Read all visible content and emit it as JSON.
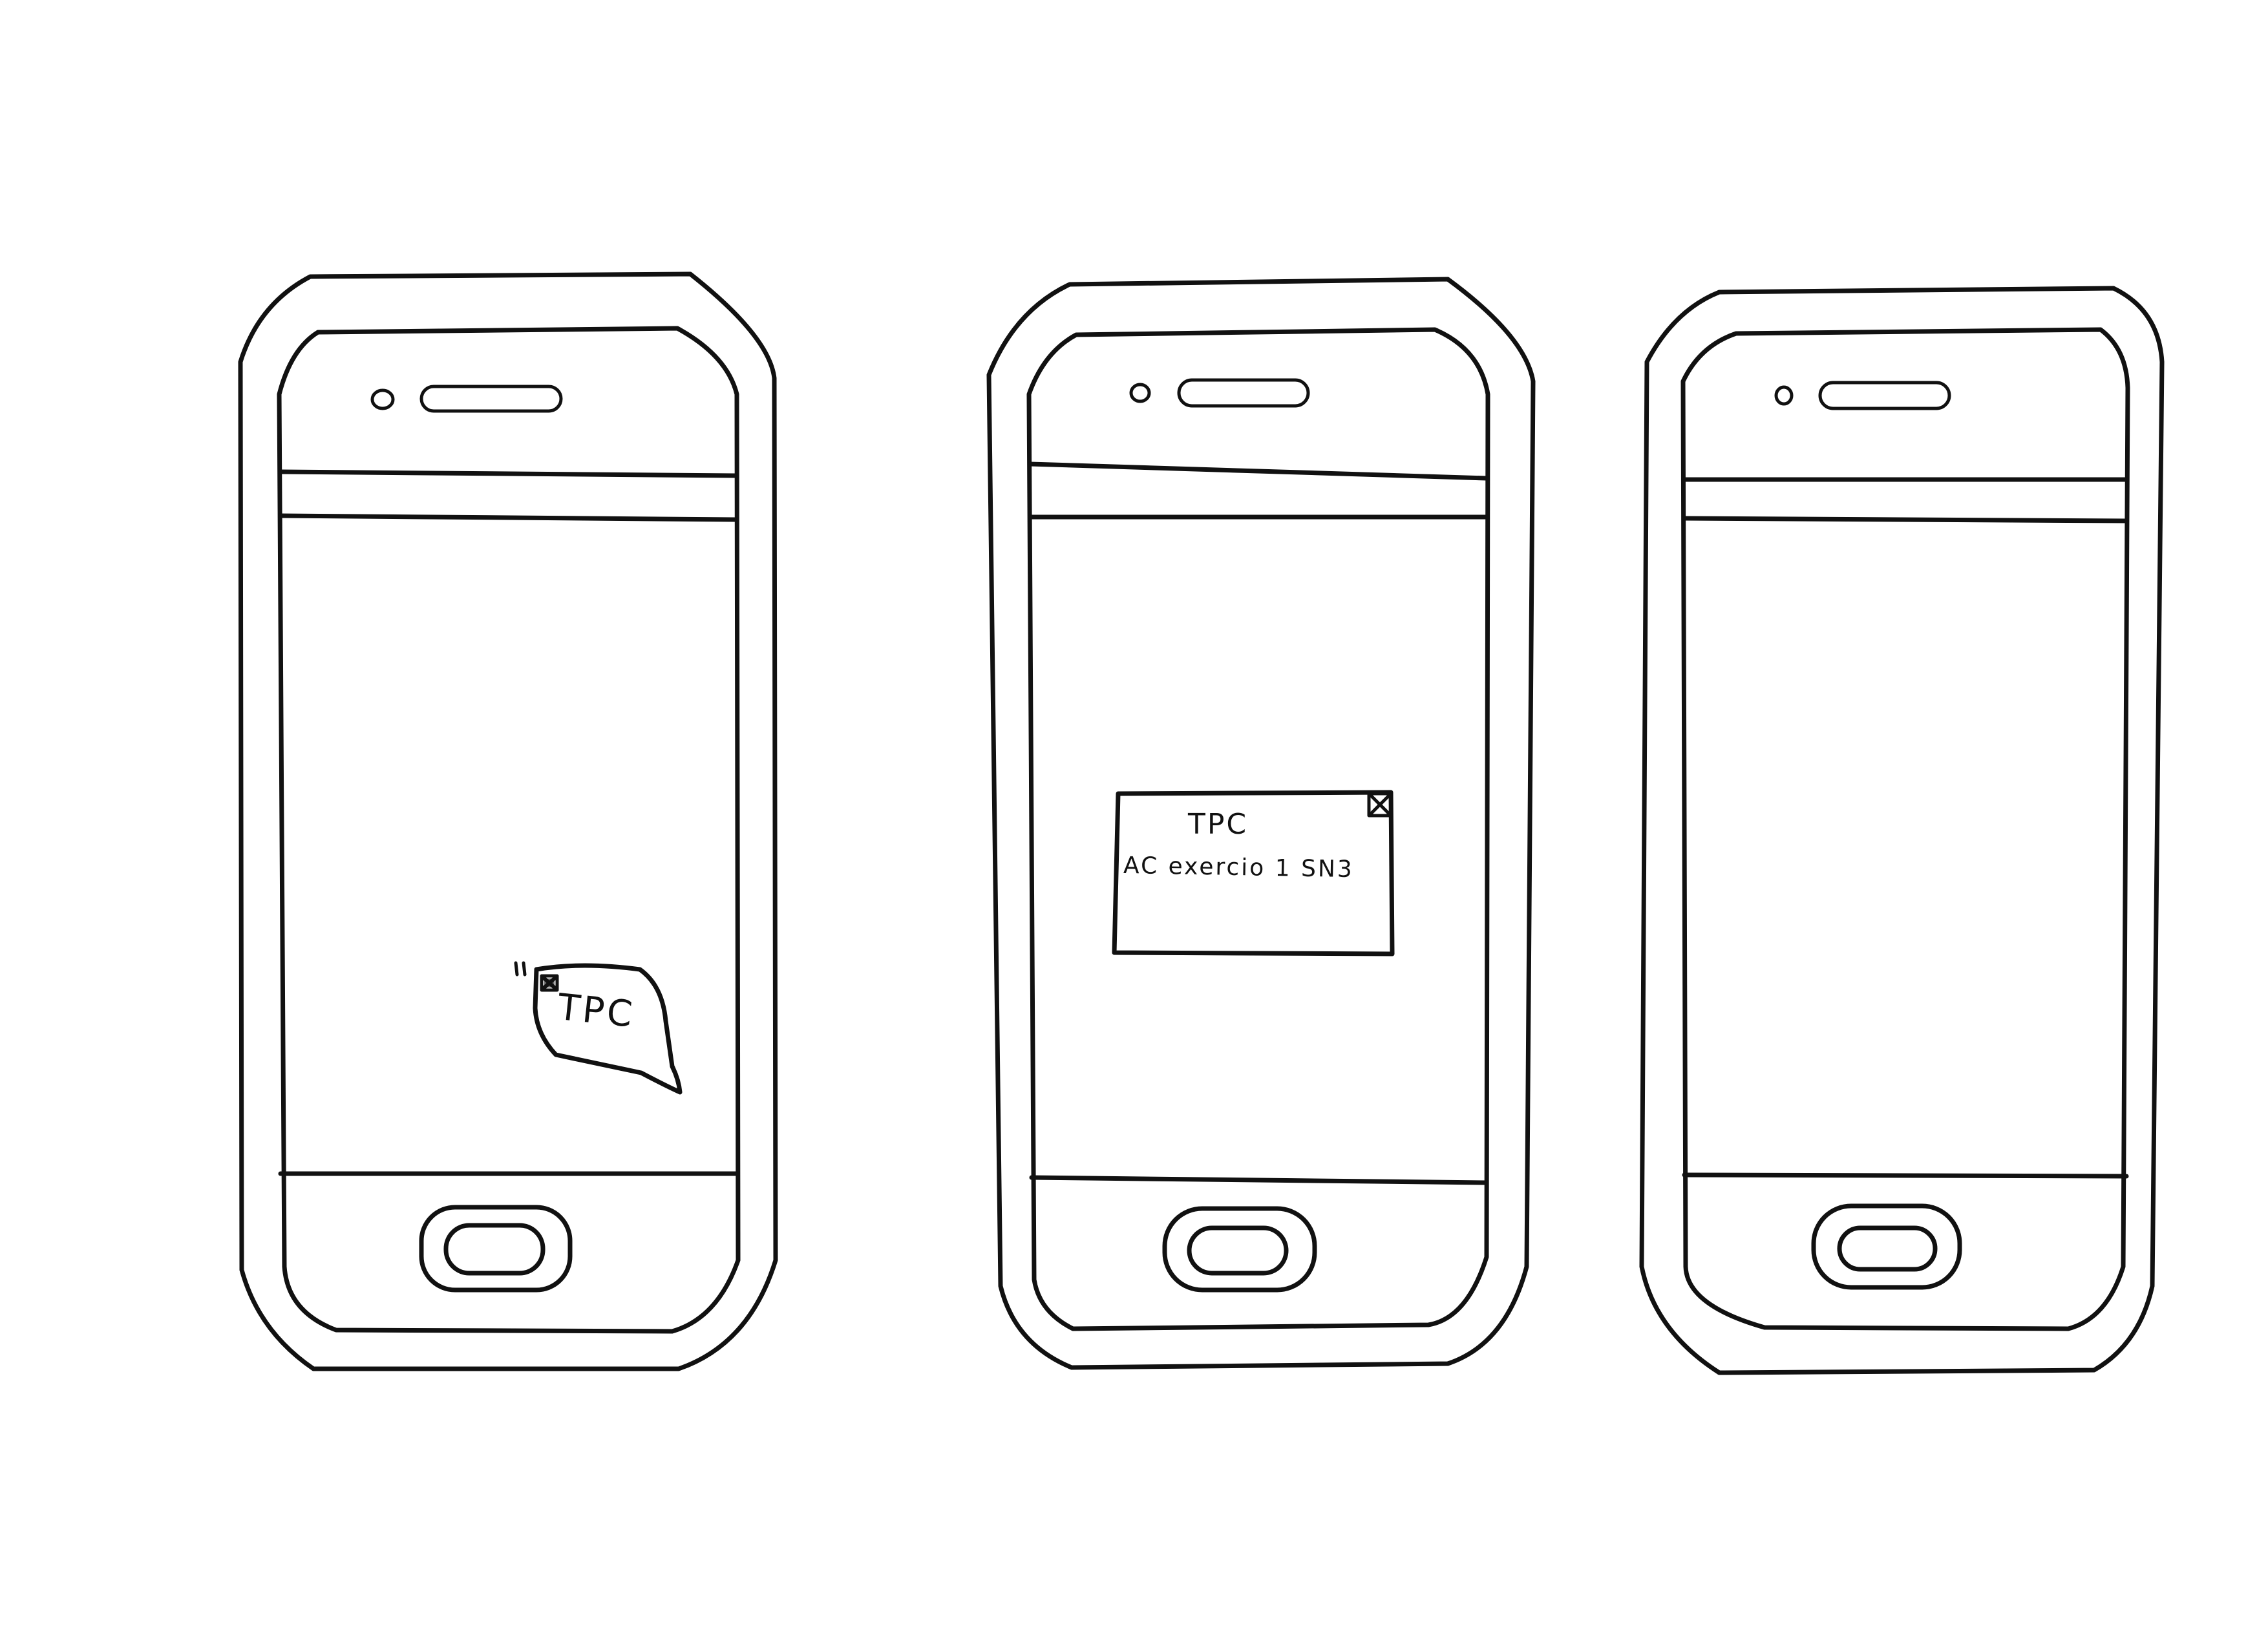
{
  "screens": [
    {
      "id": "home-with-notification",
      "notification_bubble": {
        "label": "TPC",
        "close_icon": "close-icon"
      }
    },
    {
      "id": "notification-opened",
      "dialog": {
        "title": "TPC",
        "body": "AC exercio 1 SN3",
        "close_icon": "close-icon"
      }
    },
    {
      "id": "empty-screen"
    }
  ],
  "colors": {
    "ink": "#111111",
    "paper": "#ffffff"
  }
}
